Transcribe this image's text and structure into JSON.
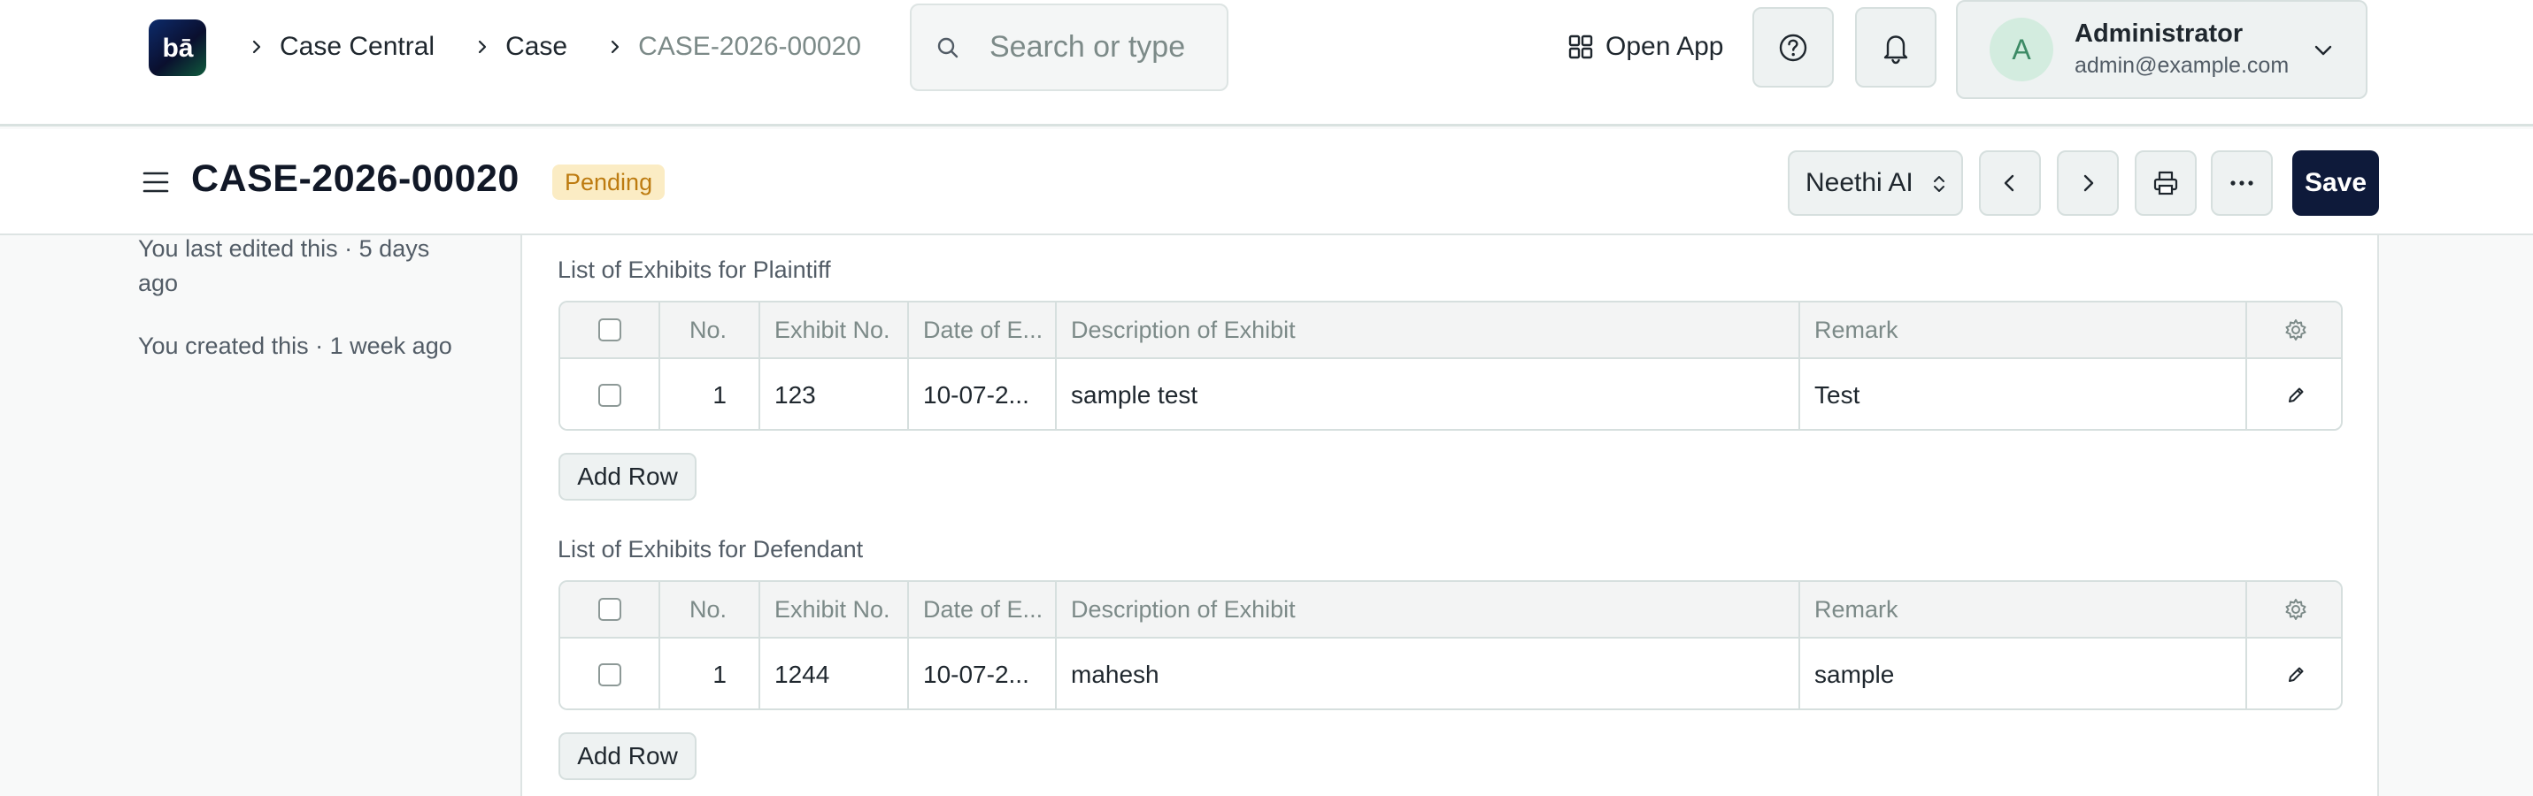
{
  "navbar": {
    "logo_text": "bā",
    "breadcrumbs": [
      {
        "label": "Case Central"
      },
      {
        "label": "Case"
      },
      {
        "label": "CASE-2026-00020"
      }
    ],
    "search_placeholder": "Search or type",
    "open_app_label": "Open App",
    "user": {
      "initial": "A",
      "name": "Administrator",
      "email": "admin@example.com"
    }
  },
  "page": {
    "title": "CASE-2026-00020",
    "status": "Pending",
    "agent_select": "Neethi AI",
    "save_label": "Save"
  },
  "activity": [
    {
      "text": "You last edited this · 5 days ago"
    },
    {
      "text": "You created this · 1 week ago"
    }
  ],
  "tables": [
    {
      "label": "List of Exhibits for Plaintiff",
      "columns": [
        "No.",
        "Exhibit No.",
        "Date of E...",
        "Description of Exhibit",
        "Remark"
      ],
      "rows": [
        {
          "no": "1",
          "exhibit_no": "123",
          "date": "10-07-2...",
          "description": "sample test",
          "remark": "Test"
        }
      ],
      "add_row_label": "Add Row"
    },
    {
      "label": "List of Exhibits for Defendant",
      "columns": [
        "No.",
        "Exhibit No.",
        "Date of E...",
        "Description of Exhibit",
        "Remark"
      ],
      "rows": [
        {
          "no": "1",
          "exhibit_no": "1244",
          "date": "10-07-2...",
          "description": "mahesh",
          "remark": "sample"
        }
      ],
      "add_row_label": "Add Row"
    }
  ],
  "icons": {
    "chevron": "chevron-right-icon",
    "search": "search-icon",
    "grid": "grid-icon",
    "help": "help-circle-icon",
    "bell": "bell-icon",
    "menu": "hamburger-icon",
    "print": "printer-icon",
    "more": "more-horizontal-icon",
    "settings": "settings-gear-icon",
    "edit": "pencil-edit-icon"
  },
  "colors": {
    "primary_button": "#0e1a3a",
    "status_badge_bg": "#fbecc4",
    "status_badge_text": "#bd7b10",
    "avatar_bg": "#d3ecdf"
  }
}
